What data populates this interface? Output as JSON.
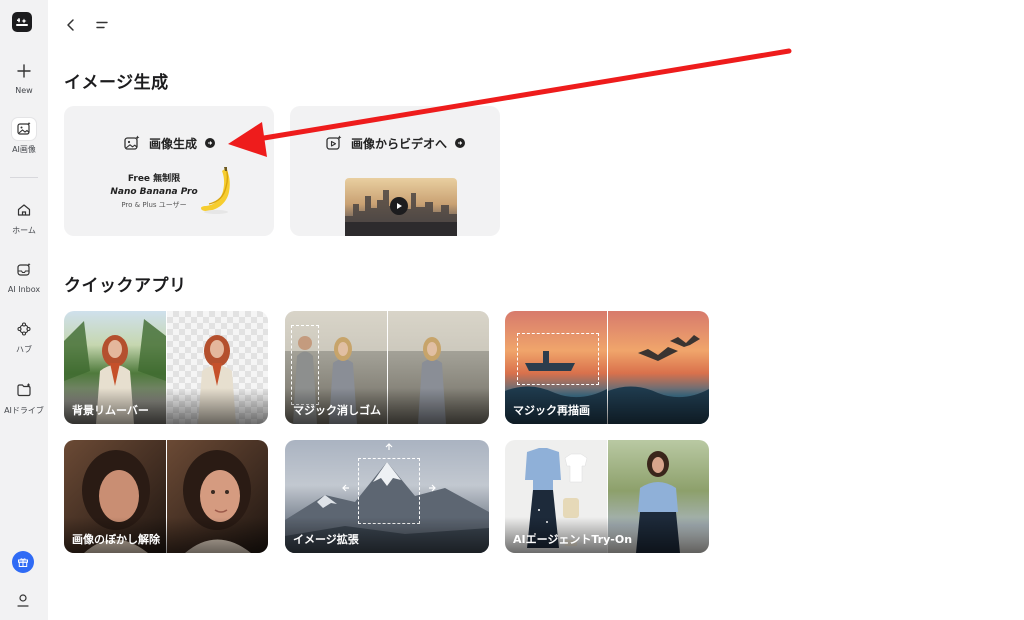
{
  "sidebar": {
    "items": [
      {
        "label": "New",
        "icon": "plus-icon"
      },
      {
        "label": "AI画像",
        "icon": "image-sparkle-icon"
      },
      {
        "label": "ホーム",
        "icon": "home-icon"
      },
      {
        "label": "AI Inbox",
        "icon": "inbox-icon"
      },
      {
        "label": "ハブ",
        "icon": "hub-icon"
      },
      {
        "label": "AIドライブ",
        "icon": "folder-icon"
      }
    ],
    "active_index": 1
  },
  "sections": {
    "image_gen_title": "イメージ生成",
    "quick_apps_title": "クイックアプリ"
  },
  "feature_cards": [
    {
      "title": "画像生成",
      "icon": "image-sparkle-icon"
    },
    {
      "title": "画像からビデオへ",
      "icon": "video-sparkle-icon"
    }
  ],
  "promo": {
    "line1": "Free 無制限",
    "line2": "Nano Banana Pro",
    "line3": "Pro & Plus ユーザー"
  },
  "quick_apps": [
    {
      "label": "背景リムーバー"
    },
    {
      "label": "マジック消しゴム"
    },
    {
      "label": "マジック再描画"
    },
    {
      "label": "画像のぼかし解除"
    },
    {
      "label": "イメージ拡張"
    },
    {
      "label": "AIエージェントTry-On"
    }
  ],
  "colors": {
    "sidebar_bg": "#f2f2f3",
    "card_bg": "#f2f2f3",
    "gift_button": "#2f6bf5",
    "annotation_arrow": "#ee1c1c"
  }
}
